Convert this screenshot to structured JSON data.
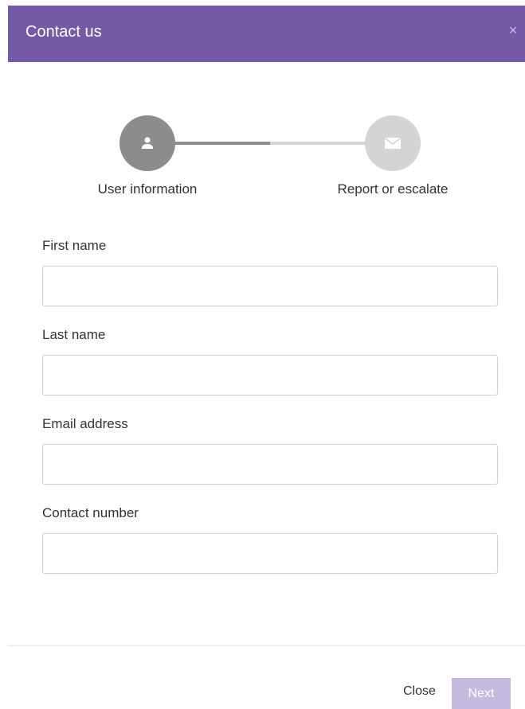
{
  "header": {
    "title": "Contact us",
    "close_symbol": "×",
    "background": "#7559a7"
  },
  "stepper": {
    "steps": [
      {
        "label": "User information",
        "icon": "user-icon",
        "state": "active"
      },
      {
        "label": "Report or escalate",
        "icon": "envelope-icon",
        "state": "inactive"
      }
    ]
  },
  "form": {
    "fields": [
      {
        "label": "First name",
        "value": ""
      },
      {
        "label": "Last name",
        "value": ""
      },
      {
        "label": "Email address",
        "value": ""
      },
      {
        "label": "Contact number",
        "value": ""
      }
    ]
  },
  "footer": {
    "close_label": "Close",
    "next_label": "Next",
    "next_color": "#c6bade"
  }
}
